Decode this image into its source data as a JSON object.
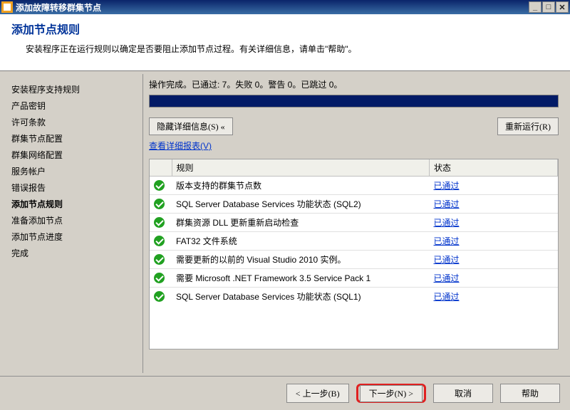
{
  "window": {
    "title": "添加故障转移群集节点"
  },
  "header": {
    "title": "添加节点规则",
    "description": "安装程序正在运行规则以确定是否要阻止添加节点过程。有关详细信息，请单击\"帮助\"。"
  },
  "sidebar": {
    "items": [
      {
        "label": "安装程序支持规则",
        "active": false
      },
      {
        "label": "产品密钥",
        "active": false
      },
      {
        "label": "许可条款",
        "active": false
      },
      {
        "label": "群集节点配置",
        "active": false
      },
      {
        "label": "群集网络配置",
        "active": false
      },
      {
        "label": "服务帐户",
        "active": false
      },
      {
        "label": "错误报告",
        "active": false
      },
      {
        "label": "添加节点规则",
        "active": true
      },
      {
        "label": "准备添加节点",
        "active": false
      },
      {
        "label": "添加节点进度",
        "active": false
      },
      {
        "label": "完成",
        "active": false
      }
    ]
  },
  "main": {
    "status_line": "操作完成。已通过: 7。失败 0。警告 0。已跳过 0。",
    "hide_details_label": "隐藏详细信息(S) «",
    "rerun_label": "重新运行(R)",
    "report_link": "查看详细报表(V)",
    "columns": {
      "rule": "规则",
      "status": "状态"
    },
    "passed_label": "已通过",
    "rows": [
      {
        "rule": "版本支持的群集节点数"
      },
      {
        "rule": "SQL Server Database Services 功能状态 (SQL2)"
      },
      {
        "rule": "群集资源 DLL 更新重新启动检查"
      },
      {
        "rule": "FAT32 文件系统"
      },
      {
        "rule": "需要更新的以前的 Visual Studio 2010 实例。"
      },
      {
        "rule": "需要 Microsoft .NET Framework 3.5 Service Pack 1"
      },
      {
        "rule": "SQL Server Database Services 功能状态 (SQL1)"
      }
    ]
  },
  "footer": {
    "back": "< 上一步(B)",
    "next": "下一步(N) >",
    "cancel": "取消",
    "help": "帮助"
  }
}
